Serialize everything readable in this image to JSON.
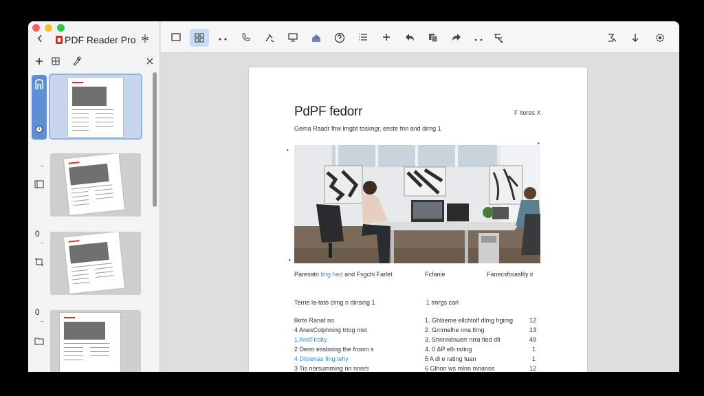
{
  "app": {
    "title": "PDF Reader Pro",
    "icons": {
      "back": "back-chevron-icon",
      "pin": "pin-icon",
      "logo": "pdf-reader-pro-logo"
    }
  },
  "sidebar": {
    "tools": [
      "add-icon",
      "grid-icon",
      "pen-icon",
      "close-icon"
    ],
    "rail": [
      {
        "icon": "bookmark-icon",
        "num": "",
        "active": true
      },
      {
        "icon": "thumbnail-view-icon",
        "num": "0",
        "active": false
      },
      {
        "icon": "crop-icon",
        "num": "0",
        "active": false
      },
      {
        "icon": "folder-icon",
        "num": "",
        "active": false
      }
    ],
    "thumbnails": [
      {
        "index": 1,
        "active": true
      },
      {
        "index": 2,
        "active": false
      },
      {
        "index": 3,
        "active": false
      },
      {
        "index": 4,
        "active": false
      }
    ]
  },
  "toolbar": {
    "buttons": [
      "single-page-icon",
      "grid-view-icon",
      "more-icon",
      "phone-icon",
      "annotate-icon",
      "present-icon",
      "share-icon",
      "help-icon",
      "list-icon",
      "add-icon",
      "undo-icon",
      "copy-icon",
      "redo-icon",
      "ellipsis-icon",
      "tools-icon",
      "signature-icon",
      "download-icon",
      "settings-icon"
    ],
    "active_index": 1,
    "accent": "#c9dcf3"
  },
  "page": {
    "title": "PdPF fedorr",
    "corner": "F ltores  X",
    "subtitle": "Gema Raadr fhw lmgbt tosimgr, enste fnn and dirng 1",
    "caption": {
      "left_prefix": "Paresatn",
      "left_link": "fing hed",
      "left_suffix": "and Fsgchi Farlet",
      "mid": "Fcfanie",
      "right": "Fanecsforasfliy ir"
    },
    "toc": {
      "heading_left": "Terne la-tato clmg n dinsing 1",
      "heading_right": "1  tmrgs carl",
      "rows": [
        {
          "left": "llkrte Ranat no",
          "left_link": false,
          "right": "1. Ghlseme ellchtolf dlmg hgimg",
          "num": "12"
        },
        {
          "left": "4 AnesColphning trtog mst",
          "left_link": false,
          "right": "2. Gmrnelhe nna tlmg",
          "num": "13"
        },
        {
          "left": "1  AndFirdity",
          "left_link": true,
          "right": "3. Shnnnénuerr nrra tled dlt",
          "num": "49"
        },
        {
          "left": "2  Derm essboing the froom s",
          "left_link": false,
          "right": "4. 0 &P elb rsting",
          "num": "1"
        },
        {
          "left": "4  Dlstenas fing tehy",
          "left_link": true,
          "right": "5  A dl e ratlng fuan",
          "num": "1"
        },
        {
          "left": "3  Tis norsumming nn nnnrs",
          "left_link": false,
          "right": "6 Glhon ws mlnn mnanos",
          "num": "12"
        }
      ]
    }
  }
}
